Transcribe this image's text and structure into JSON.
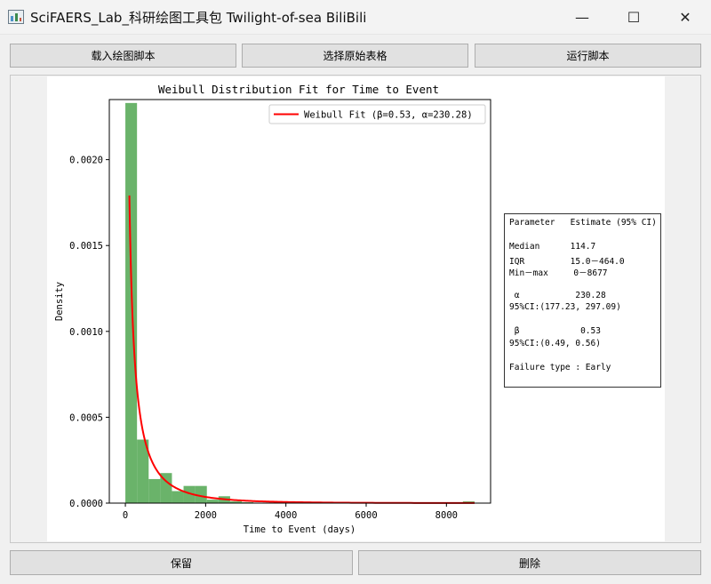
{
  "window": {
    "title": "SciFAERS_Lab_科研绘图工具包 Twilight-of-sea BiliBili",
    "minimize_glyph": "—",
    "maximize_glyph": "☐",
    "close_glyph": "✕"
  },
  "toolbar": {
    "load_script": "载入绘图脚本",
    "select_table": "选择原始表格",
    "run_script": "运行脚本"
  },
  "bottom": {
    "keep": "保留",
    "delete": "删除"
  },
  "chart_data": {
    "type": "histogram",
    "title": "Weibull Distribution Fit for Time to Event",
    "xlabel": "Time to Event (days)",
    "ylabel": "Density",
    "xlim": [
      -400,
      9100
    ],
    "ylim": [
      0,
      0.00235
    ],
    "xticks": [
      0,
      2000,
      4000,
      6000,
      8000
    ],
    "xtick_labels": [
      "0",
      "2000",
      "4000",
      "6000",
      "8000"
    ],
    "yticks": [
      0,
      0.0005,
      0.001,
      0.0015,
      0.002
    ],
    "ytick_labels": [
      "0.0000",
      "0.0005",
      "0.0010",
      "0.0015",
      "0.0020"
    ],
    "bins": [
      {
        "x0": 0,
        "x1": 290,
        "value": 0.00233
      },
      {
        "x0": 290,
        "x1": 580,
        "value": 0.00037
      },
      {
        "x0": 580,
        "x1": 870,
        "value": 0.00014
      },
      {
        "x0": 870,
        "x1": 1160,
        "value": 0.000175
      },
      {
        "x0": 1160,
        "x1": 1450,
        "value": 7e-05
      },
      {
        "x0": 1450,
        "x1": 1740,
        "value": 0.0001
      },
      {
        "x0": 1740,
        "x1": 2030,
        "value": 0.0001
      },
      {
        "x0": 2030,
        "x1": 2320,
        "value": 2e-05
      },
      {
        "x0": 2320,
        "x1": 2610,
        "value": 4e-05
      },
      {
        "x0": 2610,
        "x1": 2900,
        "value": 1e-05
      },
      {
        "x0": 2900,
        "x1": 3190,
        "value": 5e-06
      },
      {
        "x0": 8410,
        "x1": 8700,
        "value": 1e-05
      }
    ],
    "hist_color": "#5aab5a",
    "fit_curve": {
      "name": "Weibull Fit (β=0.53, α=230.28)",
      "color": "#ff0000",
      "shape": 0.53,
      "scale": 230.28,
      "x_start": 100,
      "x_end": 8700
    },
    "legend": {
      "position": "top-right",
      "label": "Weibull Fit (β=0.53, α=230.28)"
    },
    "stats_lines": [
      "Parameter   Estimate (95% CI)",
      "",
      "Median      114.7",
      "IQR         15.0－464.0",
      "Min－max     0－8677",
      "",
      " α           230.28",
      "95%CI:(177.23, 297.09)",
      "",
      " β            0.53",
      "95%CI:(0.49, 0.56)",
      "",
      "Failure type : Early"
    ]
  }
}
